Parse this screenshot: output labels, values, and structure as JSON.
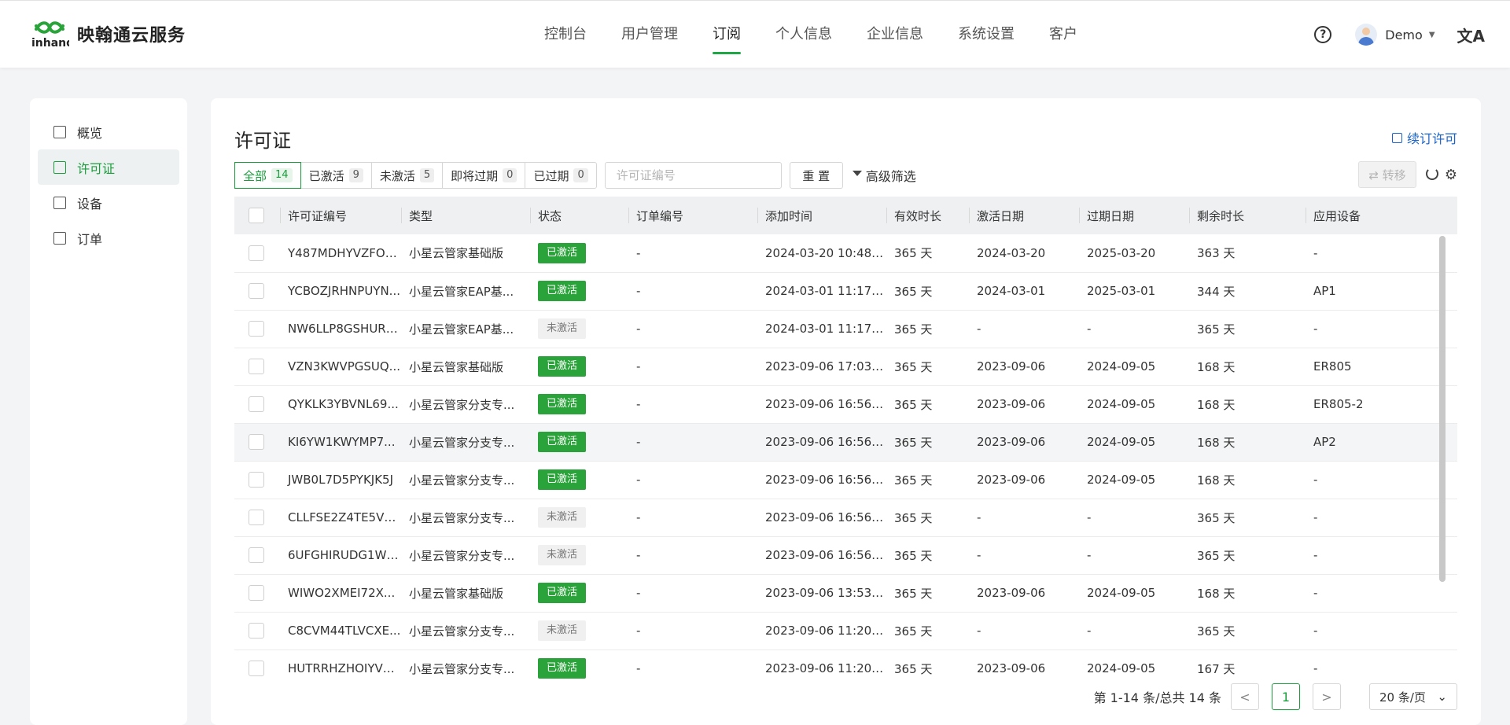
{
  "header": {
    "logo_text": "映翰通云服务",
    "nav": [
      "控制台",
      "用户管理",
      "订阅",
      "个人信息",
      "企业信息",
      "系统设置",
      "客户"
    ],
    "active_nav": 2,
    "user_name": "Demo",
    "help_icon": "?",
    "lang_icon": "文A"
  },
  "sidebar": {
    "items": [
      {
        "label": "概览",
        "icon": "monitor-icon"
      },
      {
        "label": "许可证",
        "icon": "license-icon"
      },
      {
        "label": "设备",
        "icon": "device-icon"
      },
      {
        "label": "订单",
        "icon": "order-icon"
      }
    ],
    "active": 1
  },
  "main": {
    "title": "许可证",
    "renew_label": "续订许可",
    "filters": [
      {
        "label": "全部",
        "count": "14"
      },
      {
        "label": "已激活",
        "count": "9"
      },
      {
        "label": "未激活",
        "count": "5"
      },
      {
        "label": "即将过期",
        "count": "0"
      },
      {
        "label": "已过期",
        "count": "0"
      }
    ],
    "search_placeholder": "许可证编号",
    "reset_label": "重 置",
    "advanced_label": "高级筛选",
    "transfer_label": "⇄ 转移"
  },
  "table": {
    "columns": [
      "许可证编号",
      "类型",
      "状态",
      "订单编号",
      "添加时间",
      "有效时长",
      "激活日期",
      "过期日期",
      "剩余时长",
      "应用设备"
    ],
    "rows": [
      [
        "Y487MDHYVZFOC...",
        "小星云管家基础版",
        "已激活",
        "-",
        "2024-03-20 10:48:...",
        "365 天",
        "2024-03-20",
        "2025-03-20",
        "363 天",
        "-"
      ],
      [
        "YCBOZJRHNPUYN...",
        "小星云管家EAP基...",
        "已激活",
        "-",
        "2024-03-01 11:17:...",
        "365 天",
        "2024-03-01",
        "2025-03-01",
        "344 天",
        "AP1"
      ],
      [
        "NW6LLP8GSHURK...",
        "小星云管家EAP基...",
        "未激活",
        "-",
        "2024-03-01 11:17:...",
        "365 天",
        "-",
        "-",
        "365 天",
        "-"
      ],
      [
        "VZN3KWVPGSUQ...",
        "小星云管家基础版",
        "已激活",
        "-",
        "2023-09-06 17:03:...",
        "365 天",
        "2023-09-06",
        "2024-09-05",
        "168 天",
        "ER805"
      ],
      [
        "QYKLK3YBVNL69...",
        "小星云管家分支专...",
        "已激活",
        "-",
        "2023-09-06 16:56:...",
        "365 天",
        "2023-09-06",
        "2024-09-05",
        "168 天",
        "ER805-2"
      ],
      [
        "KI6YW1KWYMP7...",
        "小星云管家分支专...",
        "已激活",
        "-",
        "2023-09-06 16:56:...",
        "365 天",
        "2023-09-06",
        "2024-09-05",
        "168 天",
        "AP2"
      ],
      [
        "JWB0L7D5PYKJK5J",
        "小星云管家分支专...",
        "已激活",
        "-",
        "2023-09-06 16:56:...",
        "365 天",
        "2023-09-06",
        "2024-09-05",
        "168 天",
        "-"
      ],
      [
        "CLLFSE2Z4TE5VCW",
        "小星云管家分支专...",
        "未激活",
        "-",
        "2023-09-06 16:56:...",
        "365 天",
        "-",
        "-",
        "365 天",
        "-"
      ],
      [
        "6UFGHIRUDG1WS...",
        "小星云管家分支专...",
        "未激活",
        "-",
        "2023-09-06 16:56:...",
        "365 天",
        "-",
        "-",
        "365 天",
        "-"
      ],
      [
        "WIWO2XMEI72X...",
        "小星云管家基础版",
        "已激活",
        "-",
        "2023-09-06 13:53:...",
        "365 天",
        "2023-09-06",
        "2024-09-05",
        "168 天",
        "-"
      ],
      [
        "C8CVM44TLVCXE...",
        "小星云管家分支专...",
        "未激活",
        "-",
        "2023-09-06 11:20:...",
        "365 天",
        "-",
        "-",
        "365 天",
        "-"
      ],
      [
        "HUTRRHZHOIYVRC...",
        "小星云管家分支专...",
        "已激活",
        "-",
        "2023-09-06 11:20:...",
        "365 天",
        "2023-09-06",
        "2024-09-05",
        "167 天",
        "-"
      ]
    ],
    "highlight_row": 5
  },
  "pagination": {
    "total_text": "第 1-14 条/总共 14 条",
    "current_page": "1",
    "prev": "<",
    "next": ">",
    "page_size": "20 条/页"
  },
  "colors": {
    "accent_green": "#1a9e3c",
    "active_badge": "#2aa33a",
    "link_blue": "#1a63c8"
  }
}
